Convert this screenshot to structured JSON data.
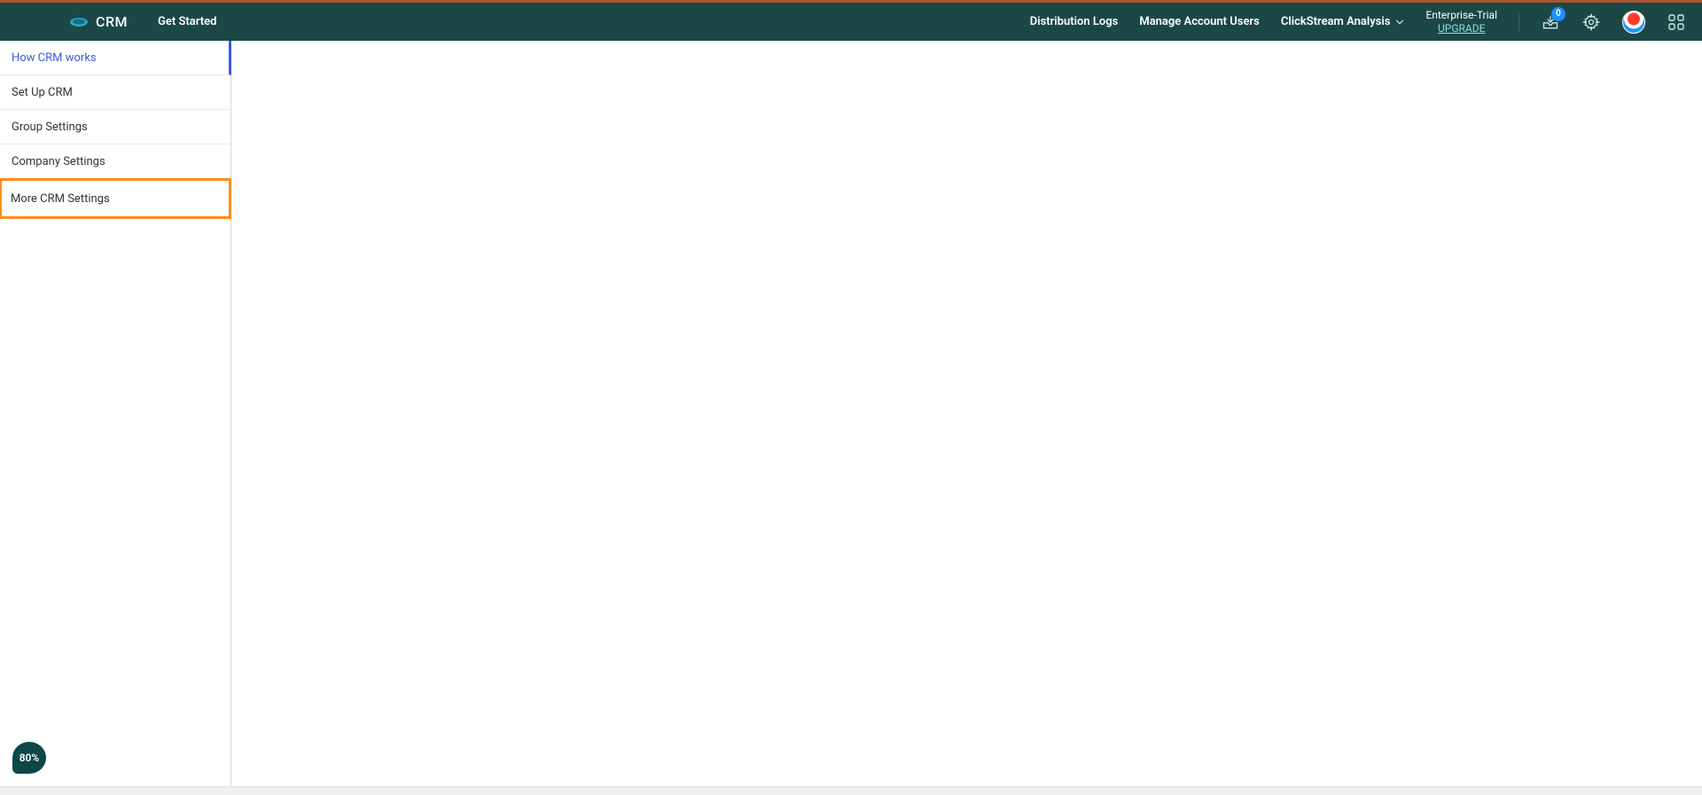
{
  "brand": {
    "name": "CRM"
  },
  "nav": {
    "get_started": "Get Started",
    "distribution_logs": "Distribution Logs",
    "manage_account_users": "Manage Account Users",
    "clickstream_analysis": "ClickStream Analysis"
  },
  "trial": {
    "label": "Enterprise-Trial",
    "upgrade": "UPGRADE"
  },
  "notifications": {
    "count": "0"
  },
  "sidebar": {
    "items": [
      {
        "label": "How CRM works"
      },
      {
        "label": "Set Up CRM"
      },
      {
        "label": "Group Settings"
      },
      {
        "label": "Company Settings"
      },
      {
        "label": "More CRM Settings"
      }
    ]
  },
  "progress": {
    "percent": "80%"
  }
}
